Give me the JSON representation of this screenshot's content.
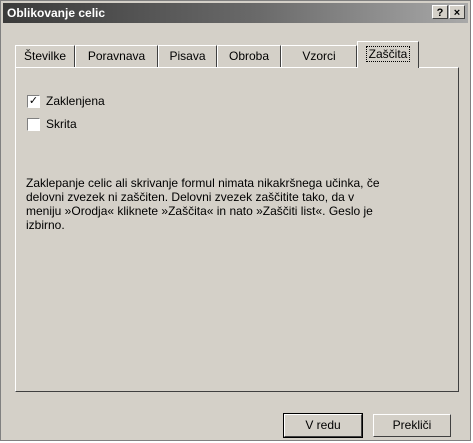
{
  "window": {
    "title": "Oblikovanje celic",
    "help_button": "?",
    "close_button": "×"
  },
  "tabs": [
    {
      "label": "Številke"
    },
    {
      "label": "Poravnava"
    },
    {
      "label": "Pisava"
    },
    {
      "label": "Obroba"
    },
    {
      "label": "Vzorci"
    },
    {
      "label": "Zaščita",
      "active": true
    }
  ],
  "protection": {
    "locked": {
      "label": "Zaklenjena",
      "checked": true,
      "mark": "✓"
    },
    "hidden": {
      "label": "Skrita",
      "checked": false,
      "mark": ""
    },
    "info_text": "Zaklepanje celic ali skrivanje formul nimata nikakršnega učinka, če delovni zvezek ni zaščiten. Delovni zvezek zaščitite tako, da v meniju »Orodja« kliknete »Zaščita« in nato »Zaščiti list«. Geslo je izbirno."
  },
  "buttons": {
    "ok": "V redu",
    "cancel": "Prekliči"
  }
}
